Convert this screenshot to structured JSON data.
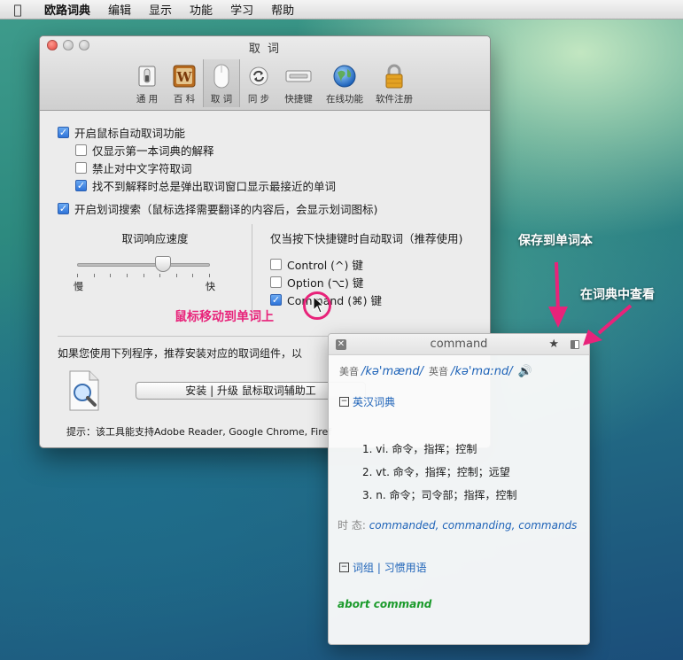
{
  "menubar": {
    "app_name": "欧路词典",
    "items": [
      "编辑",
      "显示",
      "功能",
      "学习",
      "帮助"
    ]
  },
  "window": {
    "title": "取 词",
    "toolbar": [
      {
        "label": "通 用",
        "icon": "switch-icon"
      },
      {
        "label": "百 科",
        "icon": "wiki-icon"
      },
      {
        "label": "取 词",
        "icon": "mouse-icon",
        "selected": true
      },
      {
        "label": "同 步",
        "icon": "sync-icon"
      },
      {
        "label": "快捷键",
        "icon": "keyboard-icon"
      },
      {
        "label": "在线功能",
        "icon": "globe-icon"
      },
      {
        "label": "软件注册",
        "icon": "lock-icon"
      }
    ]
  },
  "options": {
    "enable_mouse": {
      "label": "开启鼠标自动取词功能",
      "checked": true
    },
    "first_dict_only": {
      "label": "仅显示第一本词典的解释",
      "checked": false
    },
    "disable_chinese": {
      "label": "禁止对中文字符取词",
      "checked": false
    },
    "show_closest": {
      "label": "找不到解释时总是弹出取词窗口显示最接近的单词",
      "checked": true
    },
    "enable_selection": {
      "label": "开启划词搜索（鼠标选择需要翻译的内容后，会显示划词图标)",
      "checked": true
    }
  },
  "speed": {
    "title": "取词响应速度",
    "min_label": "慢",
    "max_label": "快",
    "value_fraction": 0.62
  },
  "hotkeys": {
    "title": "仅当按下快捷键时自动取词（推荐使用)",
    "control": {
      "label": "Control (^) 键",
      "checked": false
    },
    "option": {
      "label": "Option (⌥) 键",
      "checked": false
    },
    "command": {
      "label": "Command (⌘) 键",
      "checked": true
    }
  },
  "plugins": {
    "intro": "如果您使用下列程序，推荐安装对应的取词组件，以",
    "install_button": "安装 | 升级 鼠标取词辅助工",
    "hint": "提示：该工具能支持Adobe Reader, Google Chrome, Firef"
  },
  "popup": {
    "word": "command",
    "us_label": "美音",
    "us_phonetic": "/kə'mænd/",
    "uk_label": "英音",
    "uk_phonetic": "/kə'mɑːnd/",
    "section_title": "英汉词典",
    "definitions": [
      "1.  vi. 命令，指挥；控制",
      "2.  vt. 命令，指挥；控制；远望",
      "3.  n. 命令；司令部；指挥，控制"
    ],
    "tense_label": "时 态:",
    "tense_value": "commanded, commanding, commands",
    "phrases_title": "词组 | 习惯用语",
    "phrase": "abort command"
  },
  "annotations": {
    "save": "保存到单词本",
    "lookup": "在词典中查看",
    "move": "鼠标移动到单词上"
  },
  "colors": {
    "accent_pink": "#e8237a",
    "link_blue": "#1e63b8",
    "phrase_green": "#1a9a2a"
  }
}
